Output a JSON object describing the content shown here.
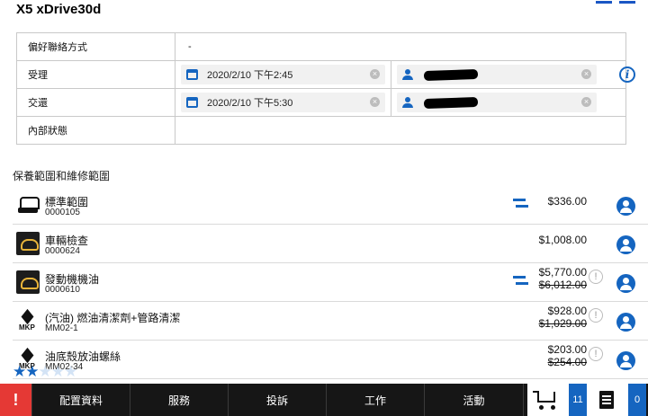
{
  "header": {
    "title": "X5 xDrive30d"
  },
  "info": {
    "rows": [
      {
        "label": "偏好聯絡方式",
        "value": "-"
      },
      {
        "label": "受理",
        "date": "2020/2/10 下午2:45"
      },
      {
        "label": "交還",
        "date": "2020/2/10 下午5:30"
      },
      {
        "label": "內部狀態"
      }
    ]
  },
  "section": {
    "title": "保養範圍和維修範圍"
  },
  "services": [
    {
      "name": "標準範圍",
      "code": "0000105",
      "price": "$336.00",
      "icon": "car-lift-icon"
    },
    {
      "name": "車輛檢查",
      "code": "0000624",
      "price": "$1,008.00",
      "icon": "vehicle-check-icon"
    },
    {
      "name": "發動機機油",
      "code": "0000610",
      "price": "$5,770.00",
      "old_price": "$6,012.00",
      "icon": "engine-oil-icon"
    },
    {
      "name": "(汽油) 燃油清潔劑+管路清潔",
      "code": "MM02-1",
      "price": "$928.00",
      "old_price": "$1,029.00",
      "icon": "mkp-icon"
    },
    {
      "name": "油底殼放油螺絲",
      "code": "MM02-34",
      "price": "$203.00",
      "old_price": "$254.00",
      "icon": "mkp-icon"
    }
  ],
  "mkp_label": "MKP",
  "rating": {
    "value": 2,
    "max": 5
  },
  "bottom_nav": {
    "alert": "!",
    "tabs": [
      "配置資料",
      "服務",
      "投訴",
      "工作",
      "活動"
    ],
    "cart_count": "11",
    "doc_count": "0"
  },
  "colors": {
    "accent": "#1565c0",
    "alert": "#e53935",
    "nav_bg": "#161616"
  }
}
